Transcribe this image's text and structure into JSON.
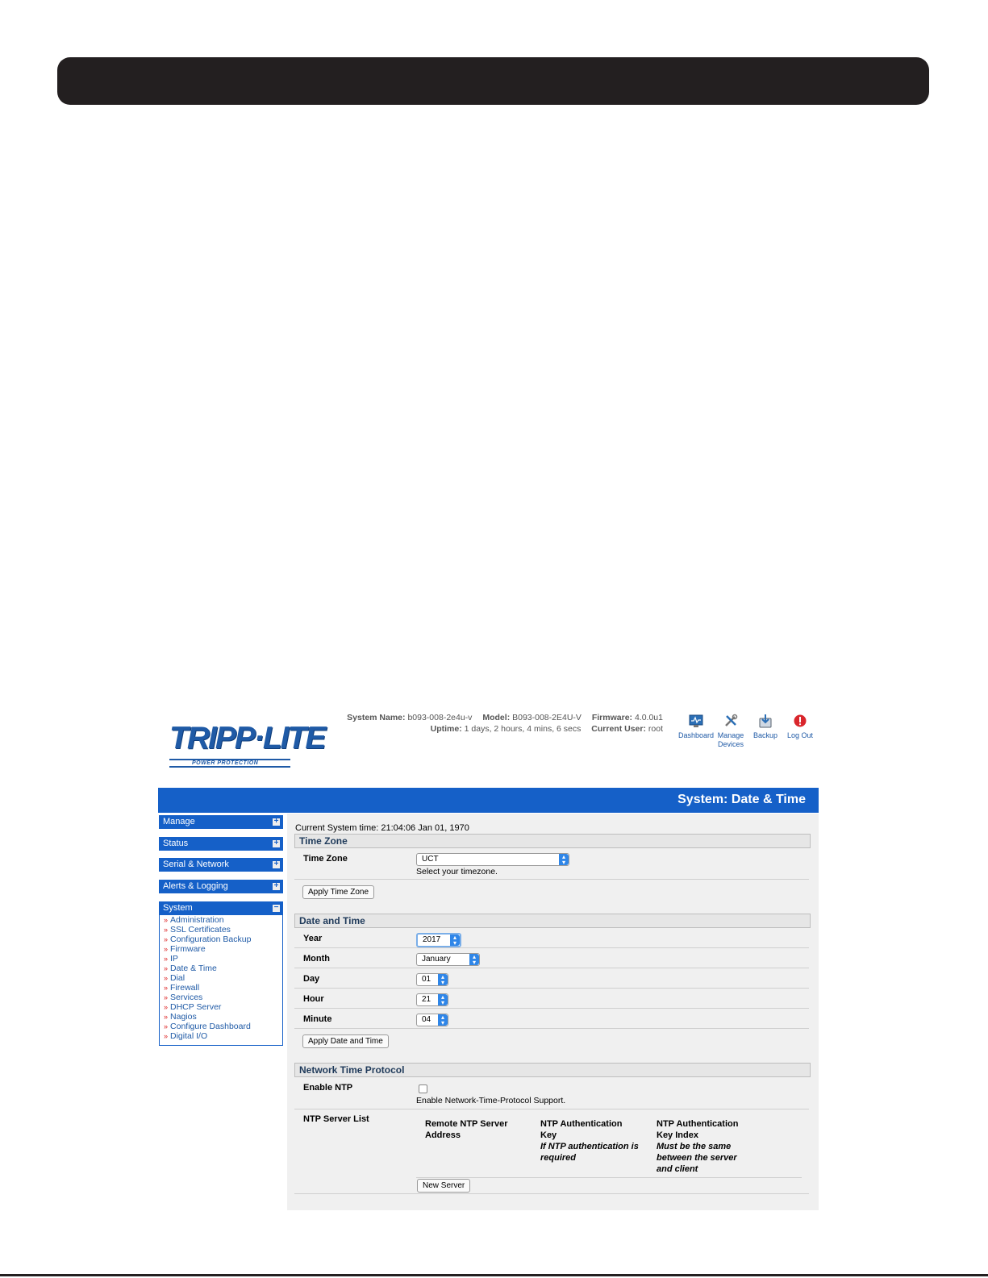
{
  "page": {},
  "ui": {
    "logo": {
      "main": "TRIPP·LITE",
      "sub": "POWER PROTECTION"
    },
    "sysinfo": {
      "system_name_label": "System Name:",
      "system_name": "b093-008-2e4u-v",
      "model_label": "Model:",
      "model": "B093-008-2E4U-V",
      "firmware_label": "Firmware:",
      "firmware": "4.0.0u1",
      "uptime_label": "Uptime:",
      "uptime": "1 days, 2 hours, 4 mins, 6 secs",
      "user_label": "Current User:",
      "user": "root"
    },
    "header_icons": [
      {
        "label": "Dashboard",
        "icon": "dashboard-icon"
      },
      {
        "label": "Manage\nDevices",
        "label1": "Manage",
        "label2": "Devices",
        "icon": "tools-icon"
      },
      {
        "label": "Backup",
        "icon": "backup-icon"
      },
      {
        "label": "Log Out",
        "icon": "power-icon"
      }
    ],
    "title": "System: Date & Time",
    "sidebar": {
      "sections": [
        "Manage",
        "Status",
        "Serial & Network",
        "Alerts & Logging",
        "System"
      ],
      "system_items": [
        "Administration",
        "SSL Certificates",
        "Configuration Backup",
        "Firmware",
        "IP",
        "Date & Time",
        "Dial",
        "Firewall",
        "Services",
        "DHCP Server",
        "Nagios",
        "Configure Dashboard",
        "Digital I/O"
      ]
    },
    "content": {
      "current_time": "Current System time: 21:04:06 Jan 01, 1970",
      "tz_section": "Time Zone",
      "tz_label": "Time Zone",
      "tz_value": "UCT",
      "tz_hint": "Select your timezone.",
      "tz_button": "Apply Time Zone",
      "dt_section": "Date and Time",
      "year_label": "Year",
      "year_value": "2017",
      "month_label": "Month",
      "month_value": "January",
      "day_label": "Day",
      "day_value": "01",
      "hour_label": "Hour",
      "hour_value": "21",
      "minute_label": "Minute",
      "minute_value": "04",
      "dt_button": "Apply Date and Time",
      "ntp_section": "Network Time Protocol",
      "ntp_enable_label": "Enable NTP",
      "ntp_enable_hint": "Enable Network-Time-Protocol Support.",
      "ntp_list_label": "NTP Server List",
      "col1_l1": "Remote NTP Server",
      "col1_l2": "Address",
      "col2_l1": "NTP Authentication",
      "col2_l2": "Key",
      "col2_n1": "If NTP authentication is",
      "col2_n2": "required",
      "col3_l1": "NTP Authentication",
      "col3_l2": "Key Index",
      "col3_n1": "Must be the same",
      "col3_n2": "between the server",
      "col3_n3": "and client",
      "new_server_button": "New Server"
    }
  }
}
